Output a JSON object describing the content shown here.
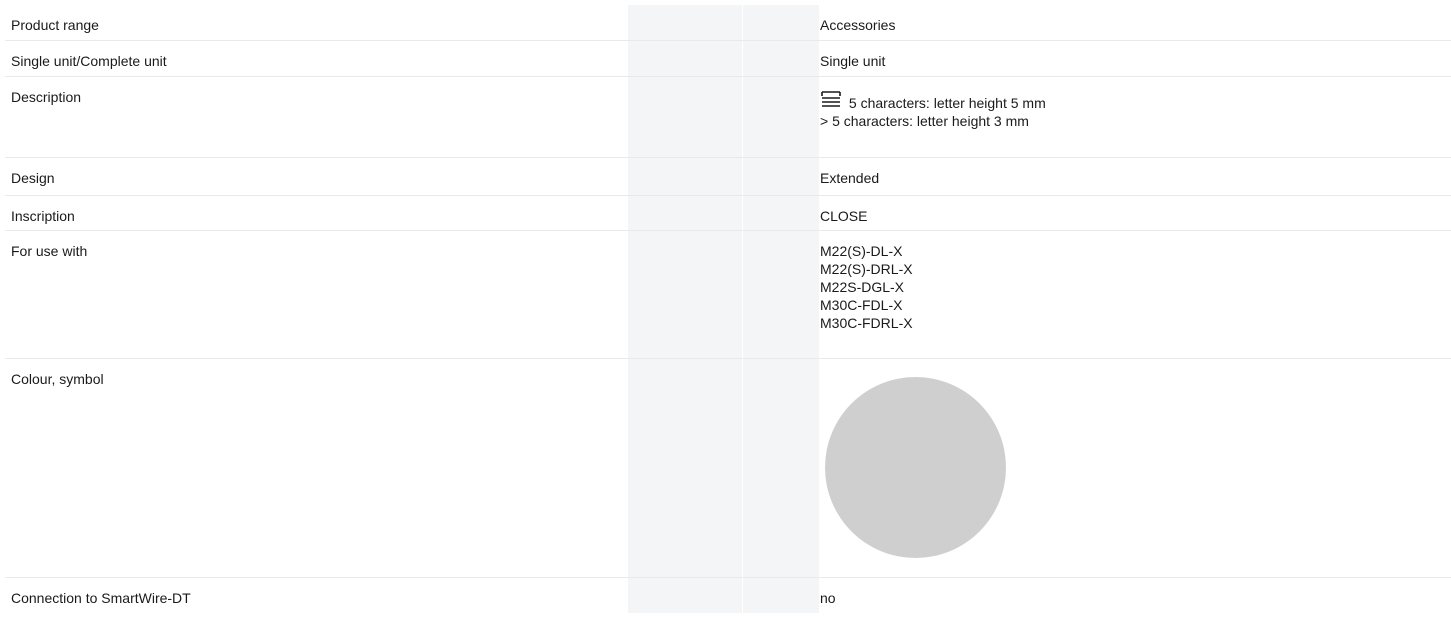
{
  "rows": [
    {
      "label": "Product range",
      "value": "Accessories"
    },
    {
      "label": "Single unit/Complete unit",
      "value": "Single unit"
    },
    {
      "label": "Description",
      "lines": [
        "5 characters: letter height 5 mm",
        "> 5 characters: letter height 3 mm"
      ]
    },
    {
      "label": "Design",
      "value": "Extended"
    },
    {
      "label": "Inscription",
      "value": "CLOSE"
    },
    {
      "label": "For use with",
      "lines": [
        "M22(S)-DL-X",
        "M22(S)-DRL-X",
        "M22S-DGL-X",
        "M30C-FDL-X",
        "M30C-FDRL-X"
      ]
    },
    {
      "label": "Colour, symbol",
      "swatch_color": "#cfcfcf"
    },
    {
      "label": "Connection to SmartWire-DT",
      "value": "no"
    }
  ],
  "icons": {
    "description_icon": "length-symbol-icon"
  },
  "colors": {
    "band_shading": "#f4f5f6",
    "row_divider": "#e8e9eb",
    "text": "#1a1a1a"
  }
}
